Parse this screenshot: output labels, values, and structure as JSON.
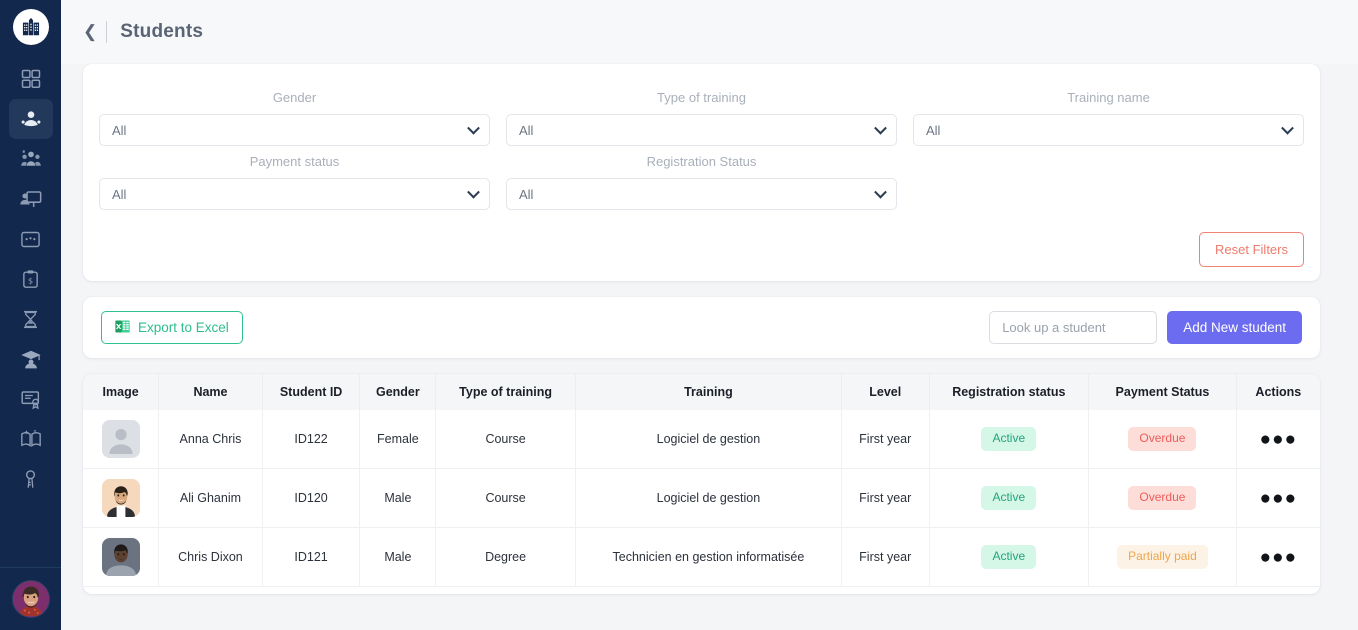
{
  "sidebar": {
    "logo_icon": "campus-building-logo",
    "items": [
      {
        "icon": "dashboard-grid-icon",
        "name": "dashboard",
        "active": false
      },
      {
        "icon": "student-icon",
        "name": "students",
        "active": true
      },
      {
        "icon": "people-group-icon",
        "name": "groups",
        "active": false
      },
      {
        "icon": "presentation-teacher-icon",
        "name": "trainers",
        "active": false
      },
      {
        "icon": "window-browser-icon",
        "name": "sessions",
        "active": false
      },
      {
        "icon": "clipboard-dollar-icon",
        "name": "payments",
        "active": false
      },
      {
        "icon": "hourglass-icon",
        "name": "pending",
        "active": false
      },
      {
        "icon": "graduation-cap-icon",
        "name": "graduates",
        "active": false
      },
      {
        "icon": "certificate-icon",
        "name": "certificates",
        "active": false
      },
      {
        "icon": "open-book-icon",
        "name": "courses",
        "active": false
      },
      {
        "icon": "keys-icon",
        "name": "access",
        "active": false
      }
    ],
    "avatar_icon": "user-avatar"
  },
  "header": {
    "back_icon": "chevron-left-icon",
    "title": "Students"
  },
  "filters": {
    "fields": [
      {
        "label": "Gender",
        "value": "All"
      },
      {
        "label": "Type of training",
        "value": "All"
      },
      {
        "label": "Training name",
        "value": "All"
      },
      {
        "label": "Payment status",
        "value": "All"
      },
      {
        "label": "Registration Status",
        "value": "All"
      }
    ],
    "reset_label": "Reset Filters",
    "reset_color": "#ee7b6c"
  },
  "toolbar": {
    "export_label": "Export to Excel",
    "export_icon": "excel-file-icon",
    "export_color": "#2ebd90",
    "search_placeholder": "Look up a student",
    "search_value": "",
    "add_label": "Add New student",
    "add_color": "#6c6cf0"
  },
  "table": {
    "columns": [
      "Image",
      "Name",
      "Student ID",
      "Gender",
      "Type of training",
      "Training",
      "Level",
      "Registration status",
      "Payment Status",
      "Actions"
    ],
    "rows": [
      {
        "image": "placeholder-avatar",
        "name": "Anna Chris",
        "student_id": "ID122",
        "gender": "Female",
        "type_of_training": "Course",
        "training": "Logiciel de gestion",
        "level": "First year",
        "registration_status": "Active",
        "payment_status": "Overdue",
        "payment_state": "overdue",
        "actions_icon": "more-options-icon"
      },
      {
        "image": "photo-avatar-male-1",
        "name": "Ali Ghanim",
        "student_id": "ID120",
        "gender": "Male",
        "type_of_training": "Course",
        "training": "Logiciel de gestion",
        "level": "First year",
        "registration_status": "Active",
        "payment_status": "Overdue",
        "payment_state": "overdue",
        "actions_icon": "more-options-icon"
      },
      {
        "image": "photo-avatar-male-2",
        "name": "Chris Dixon",
        "student_id": "ID121",
        "gender": "Male",
        "type_of_training": "Degree",
        "training": "Technicien en gestion informatisée",
        "level": "First year",
        "registration_status": "Active",
        "payment_status": "Partially paid",
        "payment_state": "partial",
        "actions_icon": "more-options-icon"
      }
    ],
    "badge_colors": {
      "active_bg": "#d4f7e7",
      "active_fg": "#24a37c",
      "overdue_bg": "#fdddd8",
      "overdue_fg": "#ef5c5c",
      "partial_bg": "#fdf2e6",
      "partial_fg": "#f0a64a"
    }
  }
}
